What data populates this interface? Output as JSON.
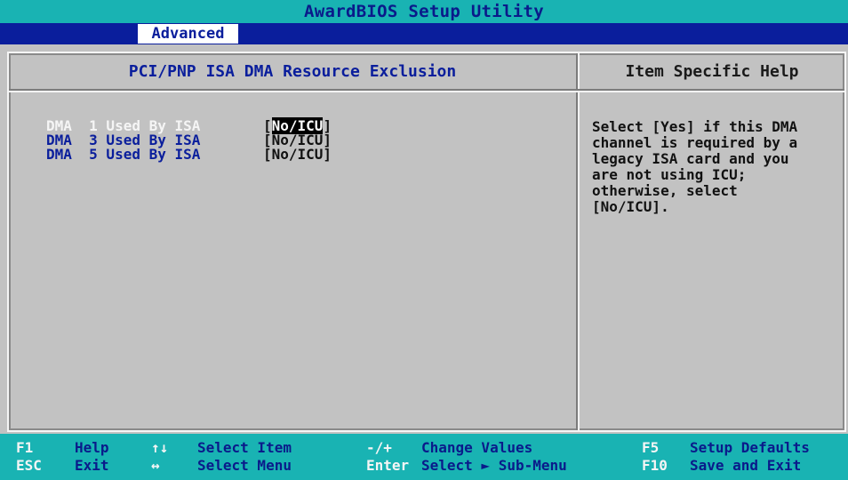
{
  "app": {
    "title": "AwardBIOS Setup Utility",
    "active_tab": "Advanced"
  },
  "panel": {
    "title": "PCI/PNP ISA DMA Resource Exclusion",
    "items": [
      {
        "label": "DMA  1 Used By ISA",
        "value": "[No/ICU]",
        "value_prefix": "[",
        "value_highlight": "No/ICU",
        "value_suffix": "]",
        "selected": true
      },
      {
        "label": "DMA  3 Used By ISA",
        "value": "[No/ICU]",
        "selected": false
      },
      {
        "label": "DMA  5 Used By ISA",
        "value": "[No/ICU]",
        "selected": false
      }
    ]
  },
  "help": {
    "title": "Item Specific Help",
    "lines": [
      "Select [Yes] if this DMA",
      "channel is required by a",
      "legacy ISA card and you",
      "are not using ICU;",
      "otherwise, select",
      "[No/ICU]."
    ]
  },
  "footer": {
    "row1": [
      {
        "key": "F1",
        "desc": "Help"
      },
      {
        "key": "↑↓",
        "desc": "Select Item"
      },
      {
        "key": "-/+",
        "desc": "Change Values"
      },
      {
        "key": "F5",
        "desc": "Setup Defaults"
      }
    ],
    "row2": [
      {
        "key": "ESC",
        "desc": "Exit"
      },
      {
        "key": "↔",
        "desc": "Select Menu"
      },
      {
        "key": "Enter",
        "desc": "Select ► Sub-Menu"
      },
      {
        "key": "F10",
        "desc": "Save and Exit"
      }
    ]
  },
  "colors": {
    "title_bar": "#19b3b3",
    "menu_bar": "#0a1e9c",
    "panel_bg": "#c2c2c2",
    "label_text": "#0a1e9c",
    "selected_label": "#f5f5f5",
    "footer_bg": "#19b3b3"
  }
}
